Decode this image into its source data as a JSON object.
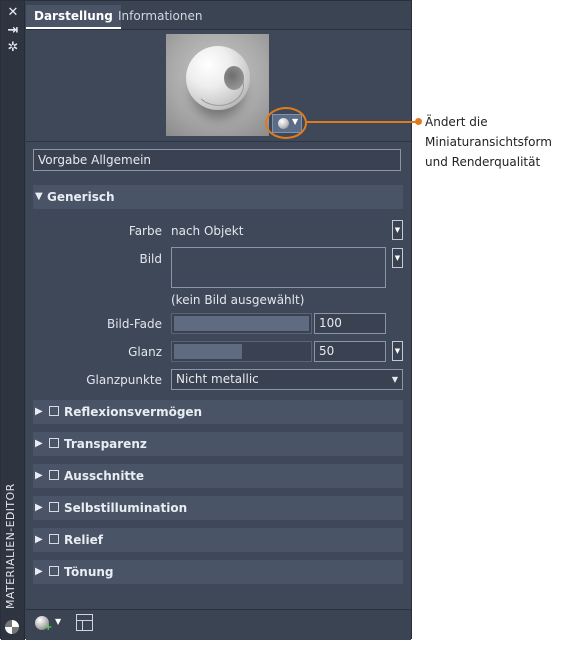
{
  "window": {
    "vertical_title": "MATERIALIEN-EDITOR",
    "side_icons": [
      "close-icon",
      "pin-icon",
      "settings-icon"
    ]
  },
  "tabs": [
    {
      "label": "Darstellung",
      "active": true
    },
    {
      "label": "Informationen",
      "active": false
    }
  ],
  "preview": {
    "thumbnail_button_icon": "sphere-icon"
  },
  "callout": {
    "text": "Ändert die Miniaturansichtsform und Renderqualität",
    "color": "#e07b1e"
  },
  "material_name": "Vorgabe Allgemein",
  "generic": {
    "title": "Generisch",
    "farbe_label": "Farbe",
    "farbe_value": "nach Objekt",
    "bild_label": "Bild",
    "bild_note": "(kein Bild ausgewählt)",
    "bildfade_label": "Bild-Fade",
    "bildfade_value": "100",
    "bildfade_level": 1.0,
    "glanz_label": "Glanz",
    "glanz_value": "50",
    "glanz_level": 0.5,
    "glanzpunkte_label": "Glanzpunkte",
    "glanzpunkte_value": "Nicht metallic"
  },
  "sections": [
    {
      "label": "Reflexionsvermögen"
    },
    {
      "label": "Transparenz"
    },
    {
      "label": "Ausschnitte"
    },
    {
      "label": "Selbstillumination"
    },
    {
      "label": "Relief"
    },
    {
      "label": "Tönung"
    }
  ],
  "bottom_toolbar": [
    "create-material-icon",
    "material-browser-icon"
  ],
  "colors": {
    "panel_bg": "#3f4858",
    "section_header_bg": "#4a5467",
    "accent": "#e07b1e"
  }
}
